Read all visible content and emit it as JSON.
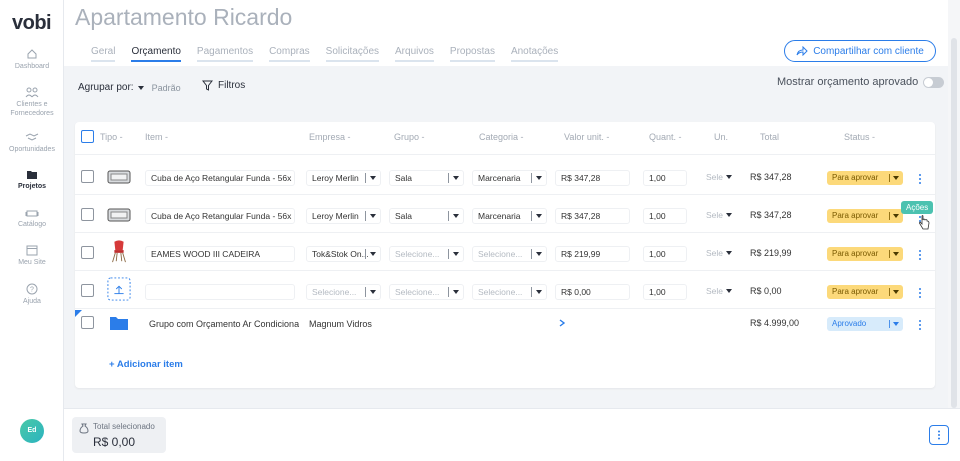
{
  "app": {
    "logo": "vobi"
  },
  "sidebar": {
    "items": [
      {
        "label": "Dashboard",
        "icon": "home-icon"
      },
      {
        "label": "Clientes e Fornecedores",
        "icon": "people-icon"
      },
      {
        "label": "Oportunidades",
        "icon": "handshake-icon"
      },
      {
        "label": "Projetos",
        "icon": "folder-icon",
        "active": true
      },
      {
        "label": "Catálogo",
        "icon": "sofa-icon"
      },
      {
        "label": "Meu Site",
        "icon": "browser-icon"
      },
      {
        "label": "Ajuda",
        "icon": "help-icon"
      }
    ],
    "avatar": "Ed"
  },
  "header": {
    "title": "Apartamento Ricardo",
    "tabs": [
      "Geral",
      "Orçamento",
      "Pagamentos",
      "Compras",
      "Solicitações",
      "Arquivos",
      "Propostas",
      "Anotações"
    ],
    "active_tab": "Orçamento",
    "share_label": "Compartilhar com cliente"
  },
  "toolbar": {
    "group_by_label": "Agrupar por:",
    "group_by_value": "Padrão",
    "filters_label": "Filtros",
    "toggle_label": "Mostrar orçamento aprovado"
  },
  "table": {
    "headers": [
      "Tipo -",
      "Item -",
      "Empresa -",
      "Grupo -",
      "Categoria -",
      "Valor unit. -",
      "Quant. -",
      "Un.",
      "Total",
      "Status -"
    ],
    "rows": [
      {
        "item": "Cuba de Aço Retangular Funda - 56x",
        "empresa": "Leroy Merlin",
        "grupo": "Sala",
        "categoria": "Marcenaria",
        "valor": "R$ 347,28",
        "quant": "1,00",
        "un": "Sele",
        "total": "R$ 347,28",
        "status": "Para aprovar"
      },
      {
        "item": "Cuba de Aço Retangular Funda - 56x",
        "empresa": "Leroy Merlin",
        "grupo": "Sala",
        "categoria": "Marcenaria",
        "valor": "R$ 347,28",
        "quant": "1,00",
        "un": "Sele",
        "total": "R$ 347,28",
        "status": "Para aprovar"
      },
      {
        "item": "EAMES WOOD III CADEIRA",
        "empresa": "Tok&Stok On...",
        "grupo": "Selecione...",
        "categoria": "Selecione...",
        "valor": "R$ 219,99",
        "quant": "1,00",
        "un": "Sele",
        "total": "R$ 219,99",
        "status": "Para aprovar"
      },
      {
        "item": "",
        "empresa": "Selecione...",
        "grupo": "Selecione...",
        "categoria": "Selecione...",
        "valor": "R$ 0,00",
        "quant": "1,00",
        "un": "Sele",
        "total": "R$ 0,00",
        "status": "Para aprovar"
      },
      {
        "item": "Grupo com Orçamento Ar Condicionado",
        "empresa": "Magnum Vidros",
        "total": "R$ 4.999,00",
        "status": "Aprovado"
      }
    ],
    "tooltip": "Ações",
    "add_item": "+ Adicionar item"
  },
  "footer": {
    "total_label": "Total selecionado",
    "total_value": "R$ 0,00"
  },
  "colors": {
    "accent": "#2b7de9",
    "pending": "#fcd97a",
    "approved": "#d7ebfb",
    "tooltip": "#4cc2b0"
  }
}
